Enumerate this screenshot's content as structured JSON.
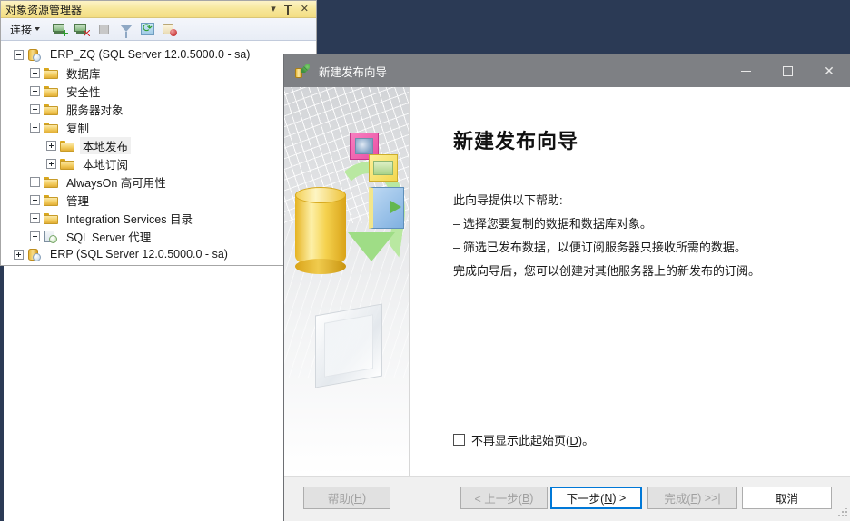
{
  "object_explorer": {
    "title": "对象资源管理器",
    "title_buttons": {
      "dropdown": "▾",
      "pin": "pin",
      "close": "✕"
    },
    "toolbar": {
      "connect_label": "连接",
      "icons": [
        "connect-object-explorer-icon",
        "disconnect-object-explorer-icon",
        "stop-icon",
        "filter-icon",
        "refresh-icon",
        "script-icon"
      ]
    },
    "tree": [
      {
        "label": "ERP_ZQ (SQL Server 12.0.5000.0 - sa)",
        "indent": 0,
        "expander": "minus",
        "icon": "server-icon",
        "selected": false
      },
      {
        "label": "数据库",
        "indent": 1,
        "expander": "plus",
        "icon": "folder-icon",
        "selected": false
      },
      {
        "label": "安全性",
        "indent": 1,
        "expander": "plus",
        "icon": "folder-icon",
        "selected": false
      },
      {
        "label": "服务器对象",
        "indent": 1,
        "expander": "plus",
        "icon": "folder-icon",
        "selected": false
      },
      {
        "label": "复制",
        "indent": 1,
        "expander": "minus",
        "icon": "folder-icon",
        "selected": false
      },
      {
        "label": "本地发布",
        "indent": 2,
        "expander": "plus",
        "icon": "folder-icon",
        "selected": true
      },
      {
        "label": "本地订阅",
        "indent": 2,
        "expander": "plus",
        "icon": "folder-icon",
        "selected": false
      },
      {
        "label": "AlwaysOn 高可用性",
        "indent": 1,
        "expander": "plus",
        "icon": "folder-icon",
        "selected": false
      },
      {
        "label": "管理",
        "indent": 1,
        "expander": "plus",
        "icon": "folder-icon",
        "selected": false
      },
      {
        "label": "Integration Services 目录",
        "indent": 1,
        "expander": "plus",
        "icon": "folder-icon",
        "selected": false
      },
      {
        "label": "SQL Server 代理",
        "indent": 1,
        "expander": "plus",
        "icon": "agent-icon",
        "selected": false
      },
      {
        "label": "ERP (SQL Server 12.0.5000.0 - sa)",
        "indent": 0,
        "expander": "plus",
        "icon": "server-icon",
        "selected": false
      }
    ]
  },
  "dialog": {
    "title": "新建发布向导",
    "window_buttons": {
      "minimize": "minimize",
      "maximize": "maximize",
      "close": "✕"
    },
    "heading": "新建发布向导",
    "body_lines": [
      "此向导提供以下帮助:",
      "– 选择您要复制的数据和数据库对象。",
      "– 筛选已发布数据，以便订阅服务器只接收所需的数据。",
      "完成向导后，您可以创建对其他服务器上的新发布的订阅。"
    ],
    "checkbox": {
      "checked": false,
      "label_before": "不再显示此起始页(",
      "label_accel": "D",
      "label_after": ")。"
    },
    "buttons": [
      {
        "name": "help",
        "text_before": "帮助(",
        "accel": "H",
        "text_after": ")",
        "state": "disabled"
      },
      {
        "name": "previous",
        "text_before": "< 上一步(",
        "accel": "B",
        "text_after": ")",
        "state": "disabled"
      },
      {
        "name": "next",
        "text_before": "下一步(",
        "accel": "N",
        "text_after": ") >",
        "state": "focused"
      },
      {
        "name": "finish",
        "text_before": "完成(",
        "accel": "F",
        "text_after": ") >>|",
        "state": "disabled"
      },
      {
        "name": "cancel",
        "text_before": "取消",
        "accel": "",
        "text_after": "",
        "state": "enabled"
      }
    ]
  },
  "colors": {
    "panel_title_gradient_start": "#fdf3c8",
    "panel_title_gradient_end": "#f3dd83",
    "dialog_titlebar": "#7e8084",
    "focus_blue": "#0078d7",
    "desktop_backdrop": "#2b3a55",
    "footer_background": "#f0f0f0"
  }
}
